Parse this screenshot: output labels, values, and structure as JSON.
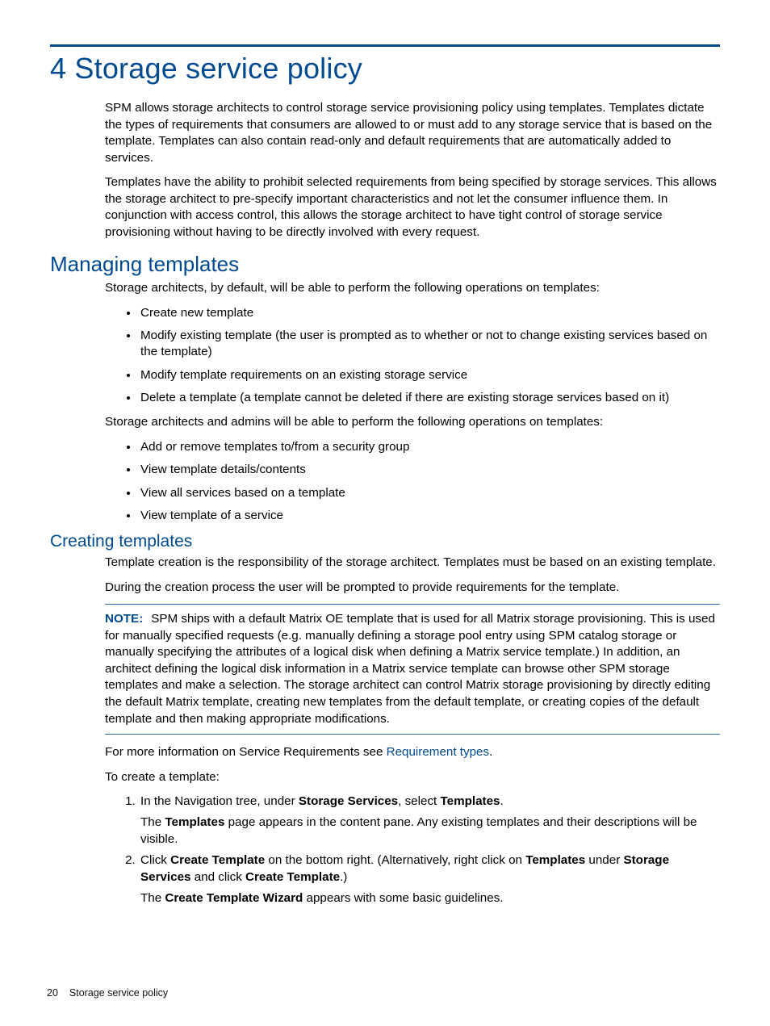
{
  "chapter": {
    "title": "4 Storage service policy"
  },
  "intro": {
    "p1": "SPM allows storage architects to control storage service provisioning policy using templates. Templates dictate the types of requirements that consumers are allowed to or must add to any storage service that is based on the template. Templates can also contain read-only and default requirements that are automatically added to services.",
    "p2": "Templates have the ability to prohibit selected requirements from being specified by storage services. This allows the storage architect to pre-specify important characteristics and not let the consumer influence them. In conjunction with access control, this allows the storage architect to have tight control of storage service provisioning without having to be directly involved with every request."
  },
  "managing": {
    "heading": "Managing templates",
    "lead": "Storage architects, by default, will be able to perform the following operations on templates:",
    "ops1": [
      "Create new template",
      "Modify existing template (the user is prompted as to whether or not to change existing services based on the template)",
      "Modify template requirements on an existing storage service",
      "Delete a template (a template cannot be deleted if there are existing storage services based on it)"
    ],
    "mid": "Storage architects and admins will be able to perform the following operations on templates:",
    "ops2": [
      "Add or remove templates to/from a security group",
      "View template details/contents",
      "View all services based on a template",
      "View template of a service"
    ]
  },
  "creating": {
    "heading": "Creating templates",
    "p1": "Template creation is the responsibility of the storage architect. Templates must be based on an existing template.",
    "p2": "During the creation process the user will be prompted to provide requirements for the template.",
    "note_label": "NOTE:",
    "note_body": "SPM ships with a default Matrix OE template that is used for all Matrix storage provisioning. This is used for manually specified requests (e.g. manually defining a storage pool entry using SPM catalog storage or manually specifying the attributes of a logical disk when defining a Matrix service template.) In addition, an architect defining the logical disk information in a Matrix service template can browse other SPM storage templates and make a selection. The storage architect can control Matrix storage provisioning by directly editing the default Matrix template, creating new templates from the default template, or creating copies of the default template and then making appropriate modifications.",
    "more_pre": "For more information on Service Requirements see ",
    "more_link": "Requirement types",
    "more_post": ".",
    "lead": "To create a template:",
    "step1": {
      "pre": "In the Navigation tree, under ",
      "b1": "Storage Services",
      "mid": ", select ",
      "b2": "Templates",
      "post": "."
    },
    "step1_after": {
      "pre": "The ",
      "b": "Templates",
      "post": " page appears in the content pane. Any existing templates and their descriptions will be visible."
    },
    "step2": {
      "pre": "Click ",
      "b1": "Create Template",
      "mid": " on the bottom right. (Alternatively, right click on ",
      "b2": "Templates",
      "mid2": " under ",
      "b3": "Storage Services",
      "mid3": " and click ",
      "b4": "Create Template",
      "post": ".)"
    },
    "step2_after": {
      "pre": "The ",
      "b": "Create Template Wizard",
      "post": " appears with some basic guidelines."
    }
  },
  "footer": {
    "page": "20",
    "title": "Storage service policy"
  }
}
